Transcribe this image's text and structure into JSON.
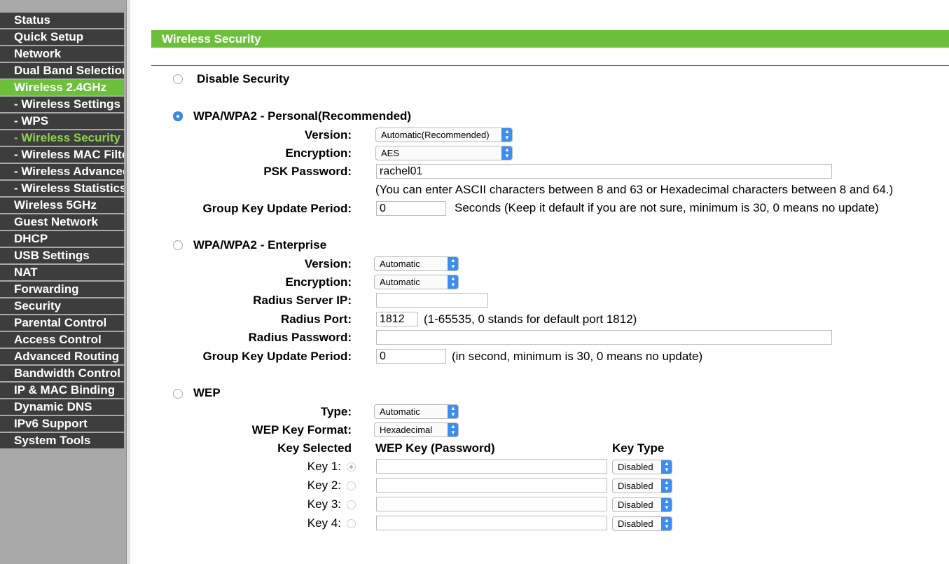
{
  "sidebar": {
    "items": [
      {
        "label": "Status",
        "state": "normal"
      },
      {
        "label": "Quick Setup",
        "state": "normal"
      },
      {
        "label": "Network",
        "state": "normal"
      },
      {
        "label": "Dual Band Selection",
        "state": "normal"
      },
      {
        "label": "Wireless 2.4GHz",
        "state": "active-parent"
      },
      {
        "label": "- Wireless Settings",
        "state": "normal"
      },
      {
        "label": "- WPS",
        "state": "normal"
      },
      {
        "label": "- Wireless Security",
        "state": "active-sub"
      },
      {
        "label": "- Wireless MAC Filtering",
        "state": "normal"
      },
      {
        "label": "- Wireless Advanced",
        "state": "normal"
      },
      {
        "label": "- Wireless Statistics",
        "state": "normal"
      },
      {
        "label": "Wireless 5GHz",
        "state": "normal"
      },
      {
        "label": "Guest Network",
        "state": "normal"
      },
      {
        "label": "DHCP",
        "state": "normal"
      },
      {
        "label": "USB Settings",
        "state": "normal"
      },
      {
        "label": "NAT",
        "state": "normal"
      },
      {
        "label": "Forwarding",
        "state": "normal"
      },
      {
        "label": "Security",
        "state": "normal"
      },
      {
        "label": "Parental Control",
        "state": "normal"
      },
      {
        "label": "Access Control",
        "state": "normal"
      },
      {
        "label": "Advanced Routing",
        "state": "normal"
      },
      {
        "label": "Bandwidth Control",
        "state": "normal"
      },
      {
        "label": "IP & MAC Binding",
        "state": "normal"
      },
      {
        "label": "Dynamic DNS",
        "state": "normal"
      },
      {
        "label": "IPv6 Support",
        "state": "normal"
      },
      {
        "label": "System Tools",
        "state": "normal"
      }
    ]
  },
  "page": {
    "title": "Wireless Security"
  },
  "disable": {
    "label": "Disable Security",
    "checked": false
  },
  "personal": {
    "label": "WPA/WPA2 - Personal(Recommended)",
    "checked": true,
    "version_label": "Version:",
    "version_value": "Automatic(Recommended)",
    "encryption_label": "Encryption:",
    "encryption_value": "AES",
    "psk_label": "PSK Password:",
    "psk_value": "rachel01",
    "psk_hint": "(You can enter ASCII characters between 8 and 63 or Hexadecimal characters between 8 and 64.)",
    "gkup_label": "Group Key Update Period:",
    "gkup_value": "0",
    "gkup_hint": "Seconds (Keep it default if you are not sure, minimum is 30, 0 means no update)"
  },
  "enterprise": {
    "label": "WPA/WPA2 - Enterprise",
    "checked": false,
    "version_label": "Version:",
    "version_value": "Automatic",
    "encryption_label": "Encryption:",
    "encryption_value": "Automatic",
    "radius_ip_label": "Radius Server IP:",
    "radius_ip_value": "",
    "radius_port_label": "Radius Port:",
    "radius_port_value": "1812",
    "radius_port_hint": "(1-65535, 0 stands for default port 1812)",
    "radius_pw_label": "Radius Password:",
    "radius_pw_value": "",
    "gkup_label": "Group Key Update Period:",
    "gkup_value": "0",
    "gkup_hint": "(in second, minimum is 30, 0 means no update)"
  },
  "wep": {
    "label": "WEP",
    "checked": false,
    "type_label": "Type:",
    "type_value": "Automatic",
    "format_label": "WEP Key Format:",
    "format_value": "Hexadecimal",
    "col_selected": "Key Selected",
    "col_key": "WEP Key (Password)",
    "col_type": "Key Type",
    "keys": [
      {
        "label": "Key 1:",
        "value": "",
        "type": "Disabled",
        "selected": true
      },
      {
        "label": "Key 2:",
        "value": "",
        "type": "Disabled",
        "selected": false
      },
      {
        "label": "Key 3:",
        "value": "",
        "type": "Disabled",
        "selected": false
      },
      {
        "label": "Key 4:",
        "value": "",
        "type": "Disabled",
        "selected": false
      }
    ]
  },
  "colors": {
    "accent_green": "#6bbf3a",
    "menu_bg": "#3d3d3d",
    "select_arrow": "#3c8df0"
  }
}
